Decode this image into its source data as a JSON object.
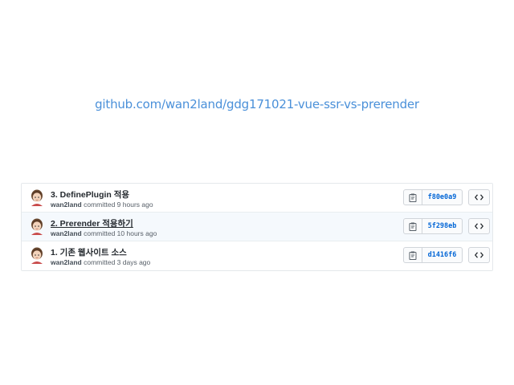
{
  "repo_link": "github.com/wan2land/gdg171021-vue-ssr-vs-prerender",
  "colors": {
    "link": "#4a90d9",
    "sha": "#0366d6",
    "row_highlight": "#f5f9fd"
  },
  "commits": [
    {
      "title": "3. DefinePlugin 적용",
      "author": "wan2land",
      "meta": "committed 9 hours ago",
      "sha": "f80e0a9",
      "icons": {
        "copy": "clipboard-icon",
        "browse": "code-icon"
      }
    },
    {
      "title": "2. Prerender 적용하기",
      "author": "wan2land",
      "meta": "committed 10 hours ago",
      "sha": "5f298eb",
      "icons": {
        "copy": "clipboard-icon",
        "browse": "code-icon"
      }
    },
    {
      "title": "1. 기존 웹사이트 소스",
      "author": "wan2land",
      "meta": "committed 3 days ago",
      "sha": "d1416f6",
      "icons": {
        "copy": "clipboard-icon",
        "browse": "code-icon"
      }
    }
  ]
}
